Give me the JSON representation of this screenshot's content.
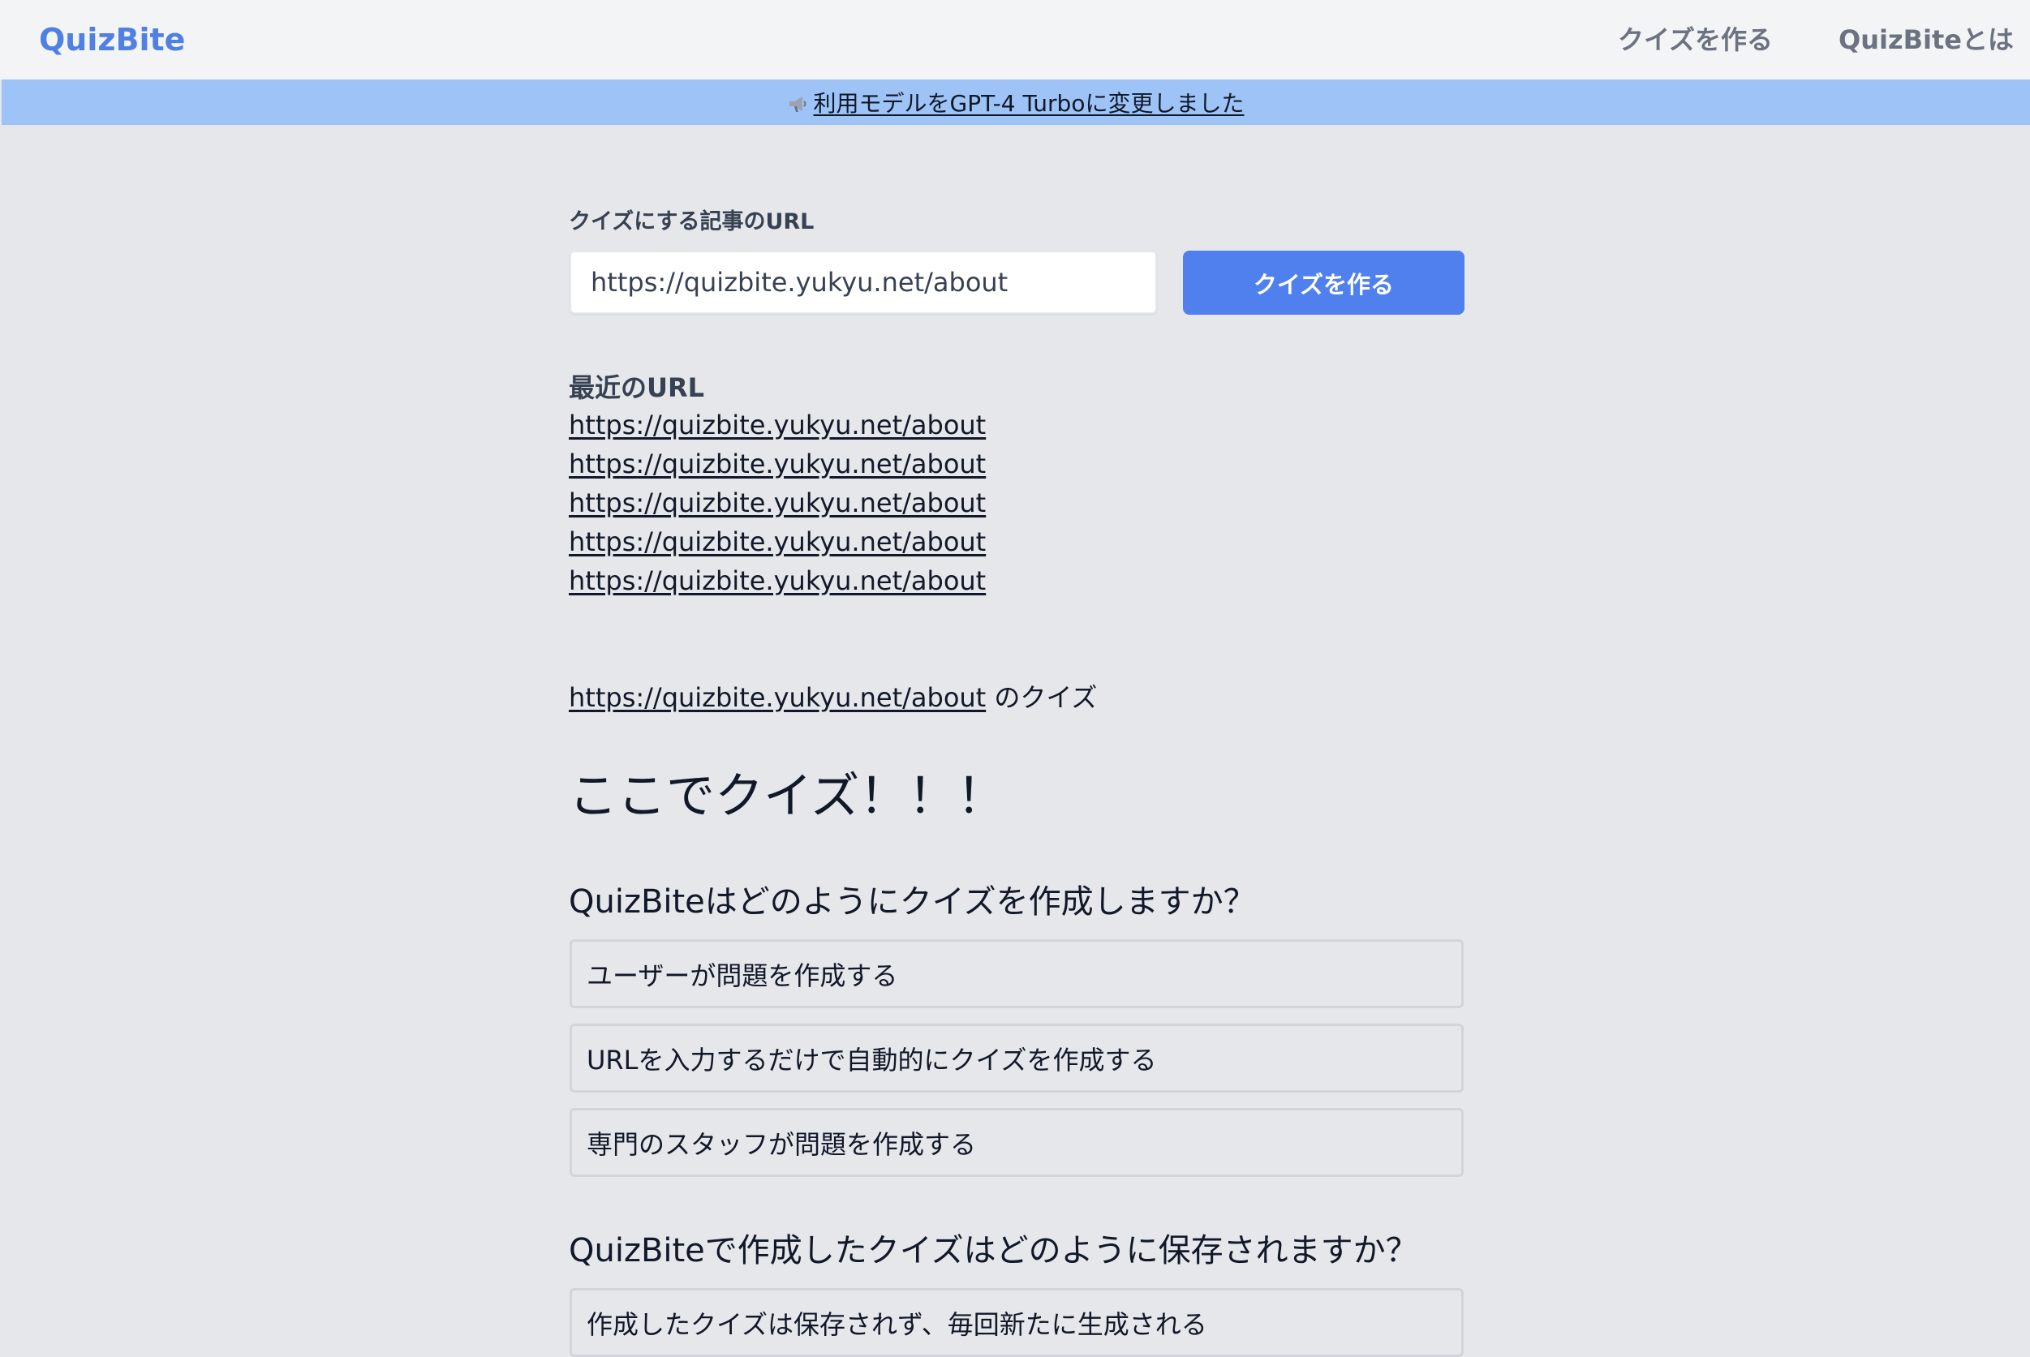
{
  "header": {
    "brand": "QuizBite",
    "nav": {
      "create": "クイズを作る",
      "about": "QuizBiteとは"
    }
  },
  "banner": {
    "icon": "megaphone-icon",
    "text": "利用モデルをGPT-4 Turboに変更しました"
  },
  "form": {
    "label": "クイズにする記事のURL",
    "url_value": "https://quizbite.yukyu.net/about",
    "button_label": "クイズを作る"
  },
  "recent": {
    "title": "最近のURL",
    "items": [
      "https://quizbite.yukyu.net/about",
      "https://quizbite.yukyu.net/about",
      "https://quizbite.yukyu.net/about",
      "https://quizbite.yukyu.net/about",
      "https://quizbite.yukyu.net/about"
    ]
  },
  "quiz": {
    "source_url": "https://quizbite.yukyu.net/about",
    "source_suffix": " のクイズ",
    "heading": "ここでクイズ！！！",
    "questions": [
      {
        "text": "QuizBiteはどのようにクイズを作成しますか？",
        "options": [
          "ユーザーが問題を作成する",
          "URLを入力するだけで自動的にクイズを作成する",
          "専門のスタッフが問題を作成する"
        ]
      },
      {
        "text": "QuizBiteで作成したクイズはどのように保存されますか？",
        "options": [
          "作成したクイズは保存されず、毎回新たに生成される"
        ]
      }
    ]
  },
  "colors": {
    "brand": "#4f80e2",
    "banner": "#9dc3f7",
    "button": "#4f80ee",
    "background": "#e5e7eb"
  }
}
